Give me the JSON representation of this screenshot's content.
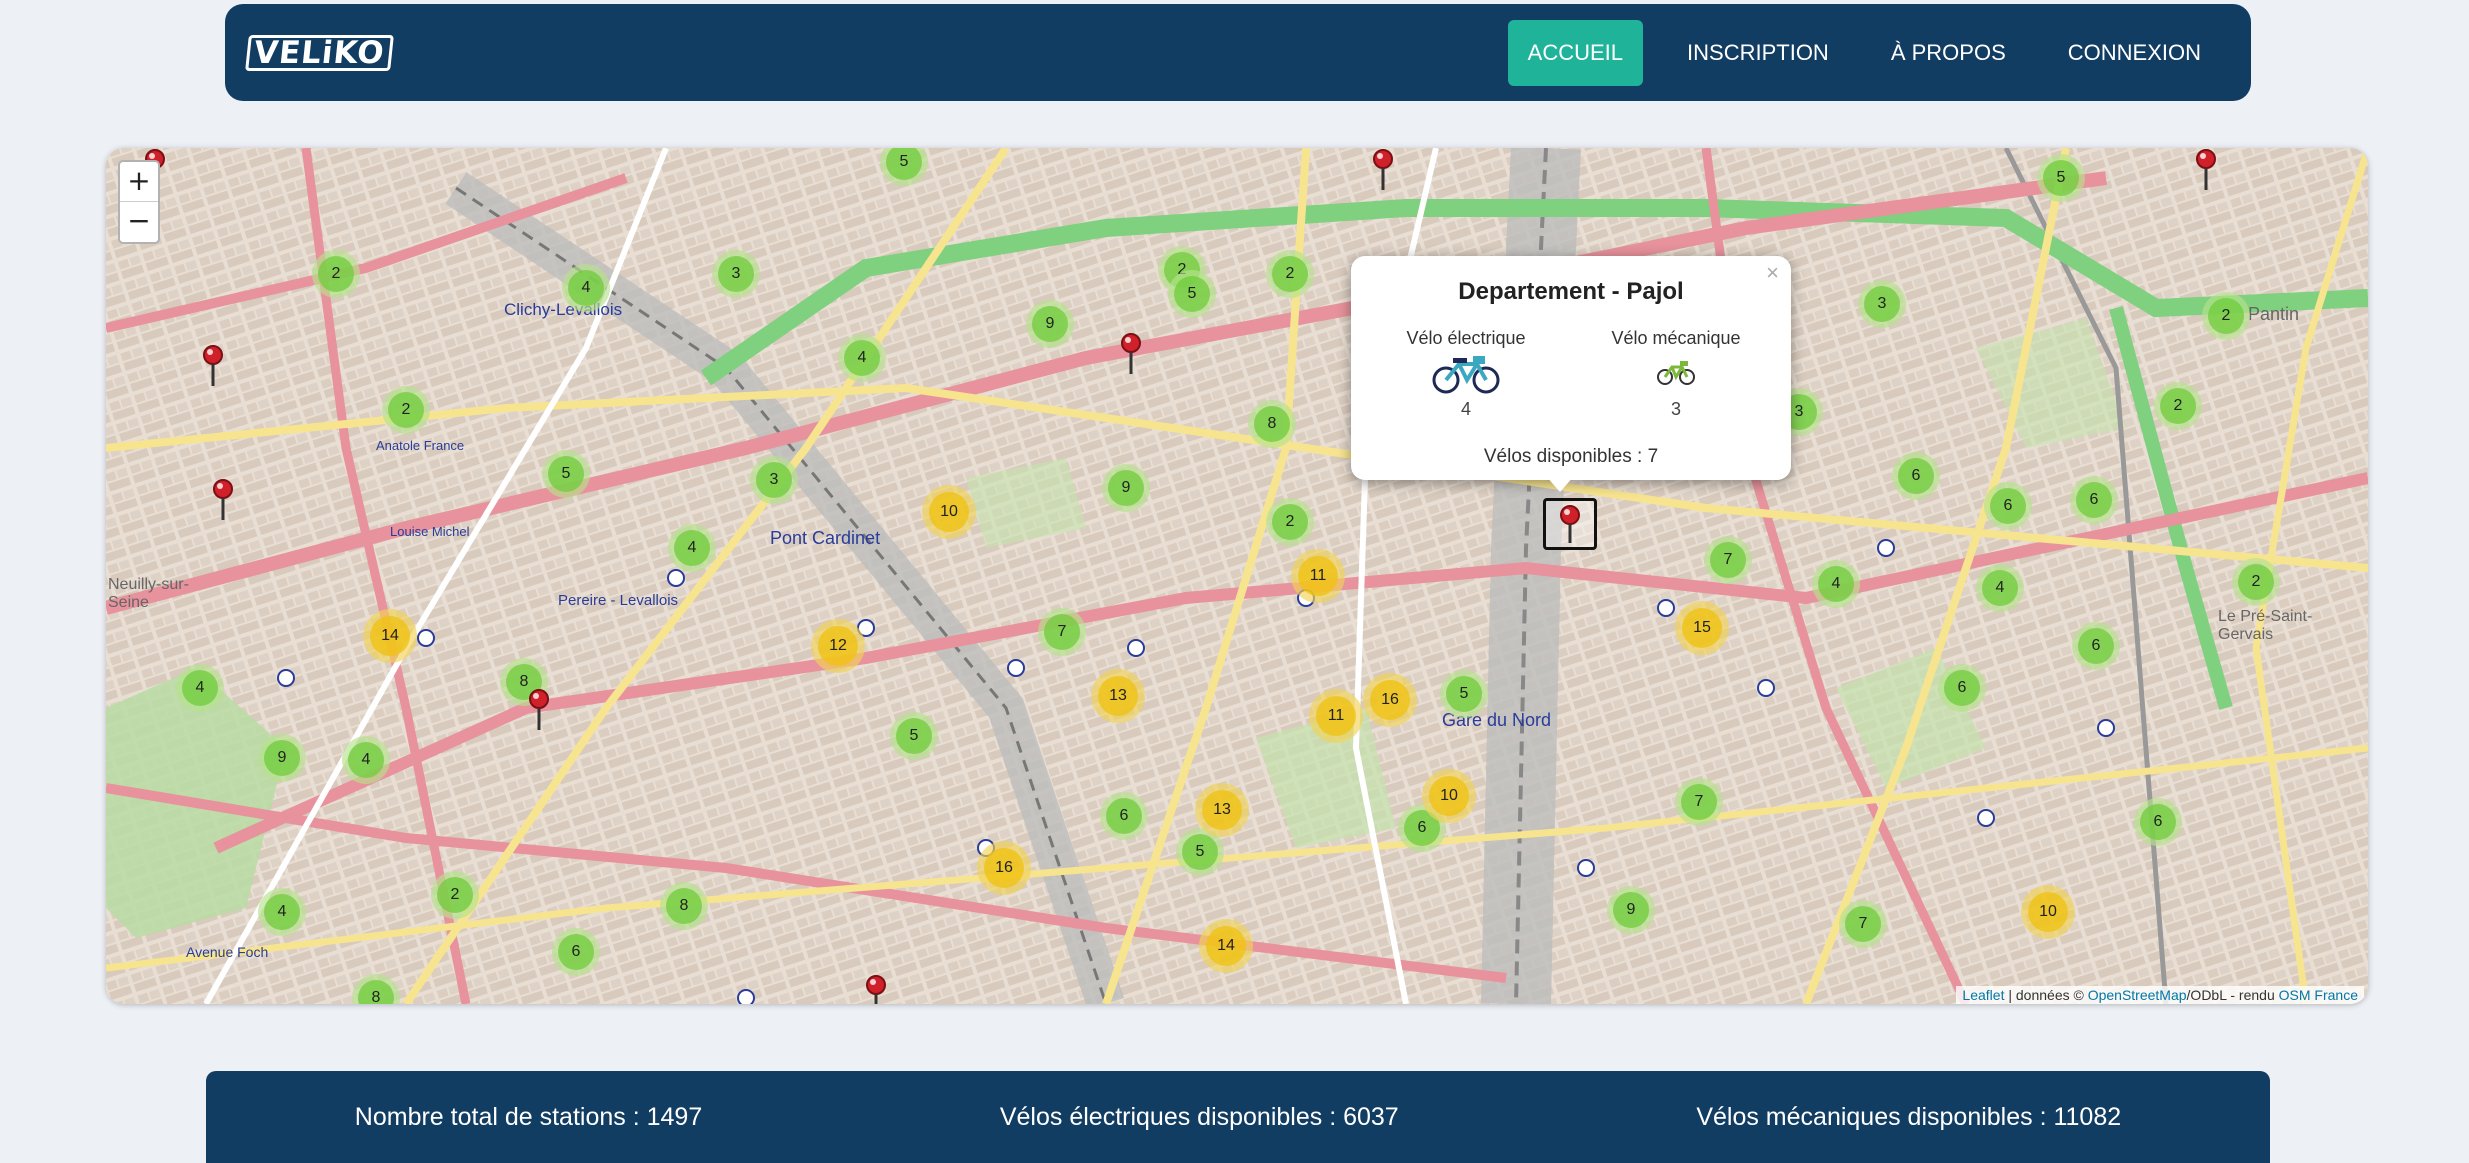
{
  "navbar": {
    "logo": "VELiKO",
    "links": [
      {
        "label": "ACCUEIL",
        "active": true
      },
      {
        "label": "INSCRIPTION",
        "active": false
      },
      {
        "label": "À PROPOS",
        "active": false
      },
      {
        "label": "CONNEXION",
        "active": false
      }
    ]
  },
  "map": {
    "zoom_in": "+",
    "zoom_out": "−",
    "popup": {
      "close": "×",
      "title": "Departement - Pajol",
      "electric_label": "Vélo électrique",
      "electric_count": "4",
      "mechanical_label": "Vélo mécanique",
      "mechanical_count": "3",
      "total": "Vélos disponibles : 7"
    },
    "attribution": {
      "leaflet": "Leaflet",
      "text1": " | données © ",
      "osm": "OpenStreetMap",
      "text2": "/ODbL - rendu ",
      "osmfr": "OSM France"
    },
    "place_labels": [
      "Clichy-Levallois",
      "Pont Cardinet",
      "Pereire - Levallois",
      "Gare du Nord",
      "Pantin",
      "Le Pré-Saint-Gervais",
      "Neuilly-sur-Seine",
      "Anatole France",
      "Louise Michel",
      "Avenue Foch"
    ],
    "clusters": [
      "5",
      "2",
      "4",
      "3",
      "2",
      "9",
      "4",
      "2",
      "5",
      "3",
      "3",
      "2",
      "2",
      "5",
      "3",
      "5",
      "4",
      "10",
      "9",
      "8",
      "6",
      "4",
      "2",
      "6",
      "14",
      "12",
      "7",
      "2",
      "11",
      "15",
      "4",
      "4",
      "2",
      "6",
      "8",
      "5",
      "13",
      "16",
      "5",
      "6",
      "9",
      "4",
      "6",
      "11",
      "5",
      "16",
      "6",
      "13",
      "10",
      "7",
      "6",
      "2",
      "4",
      "8",
      "6",
      "8",
      "14",
      "9",
      "7",
      "10",
      "6",
      "7"
    ],
    "colors": {
      "small_cluster": "#6ecc39",
      "medium_cluster": "#f0c20c",
      "pin": "#d0202a"
    }
  },
  "stats": {
    "stations": "Nombre total de stations : 1497",
    "electric": "Vélos électriques disponibles : 6037",
    "mechanical": "Vélos mécaniques disponibles : 11082"
  },
  "colors": {
    "navy": "#123d63",
    "accent": "#1fb49a",
    "background": "#edf0f5"
  }
}
